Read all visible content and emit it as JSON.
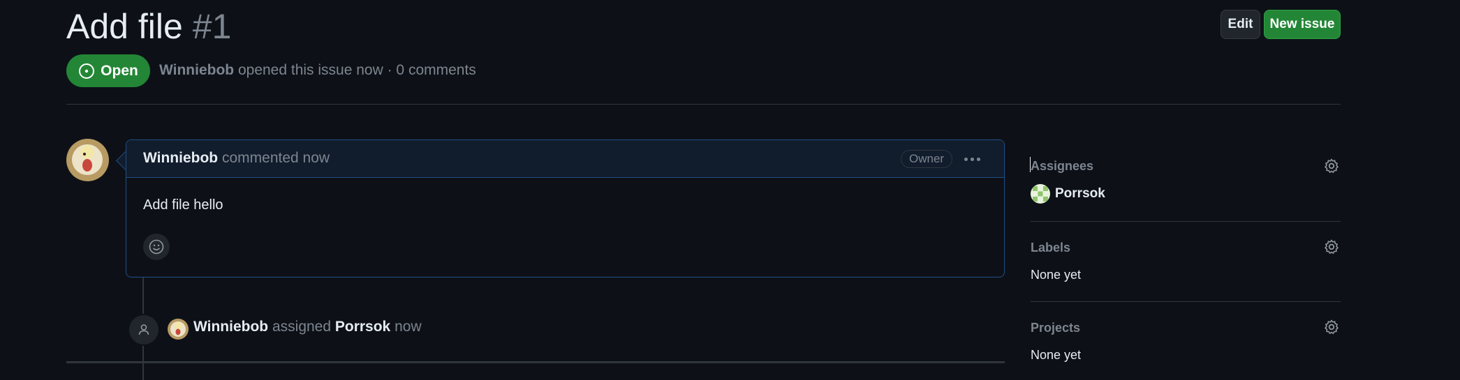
{
  "issue": {
    "title": "Add file",
    "number": "#1",
    "state_label": "Open",
    "author": "Winniebob",
    "meta_text": "opened this issue now · 0 comments"
  },
  "header_buttons": {
    "edit_label": "Edit",
    "new_issue_label": "New issue"
  },
  "comment": {
    "author": "Winniebob",
    "action": "commented now",
    "role_badge": "Owner",
    "body": "Add file hello"
  },
  "timeline_event": {
    "actor": "Winniebob",
    "verb": "assigned",
    "target": "Porrsok",
    "time": "now"
  },
  "sidebar": {
    "assignees_label": "Assignees",
    "assignee_name": "Porrsok",
    "labels_label": "Labels",
    "labels_value": "None yet",
    "projects_label": "Projects",
    "projects_value": "None yet"
  },
  "colors": {
    "background": "#0d1117",
    "open_green": "#238636",
    "muted_text": "#7d8590",
    "comment_border": "#1f4f85"
  },
  "icons": [
    "issue-open-icon",
    "kebab-icon",
    "smiley-icon",
    "person-icon",
    "gear-icon"
  ]
}
